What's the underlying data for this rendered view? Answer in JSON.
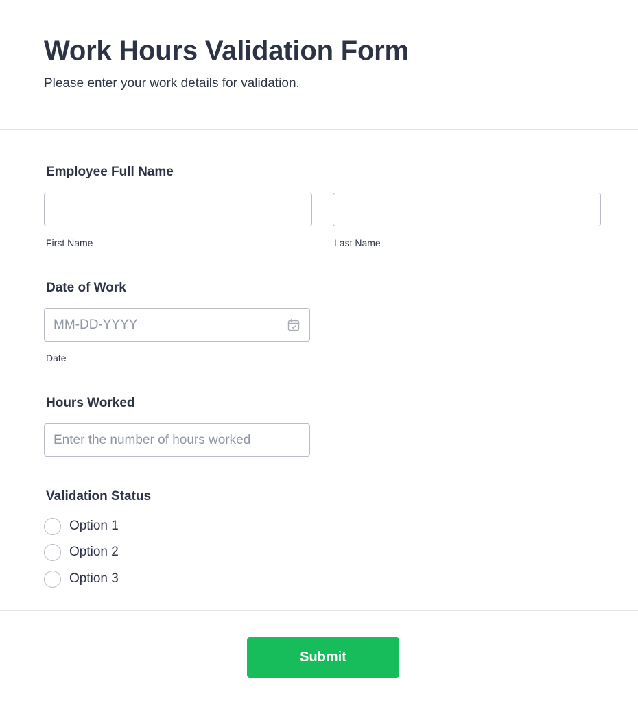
{
  "header": {
    "title": "Work Hours Validation Form",
    "subtitle": "Please enter your work details for validation."
  },
  "employee_name": {
    "label": "Employee Full Name",
    "first_name": {
      "value": "",
      "sublabel": "First Name"
    },
    "last_name": {
      "value": "",
      "sublabel": "Last Name"
    }
  },
  "date_of_work": {
    "label": "Date of Work",
    "value": "",
    "placeholder": "MM-DD-YYYY",
    "sublabel": "Date",
    "icon": "calendar-icon"
  },
  "hours_worked": {
    "label": "Hours Worked",
    "value": "",
    "placeholder": "Enter the number of hours worked"
  },
  "validation_status": {
    "label": "Validation Status",
    "options": [
      "Option 1",
      "Option 2",
      "Option 3"
    ],
    "selected": null
  },
  "submit": {
    "label": "Submit"
  },
  "colors": {
    "text": "#2c3345",
    "border": "#b8bdc9",
    "placeholder": "#8f96a3",
    "submit_bg": "#18bd5b"
  }
}
